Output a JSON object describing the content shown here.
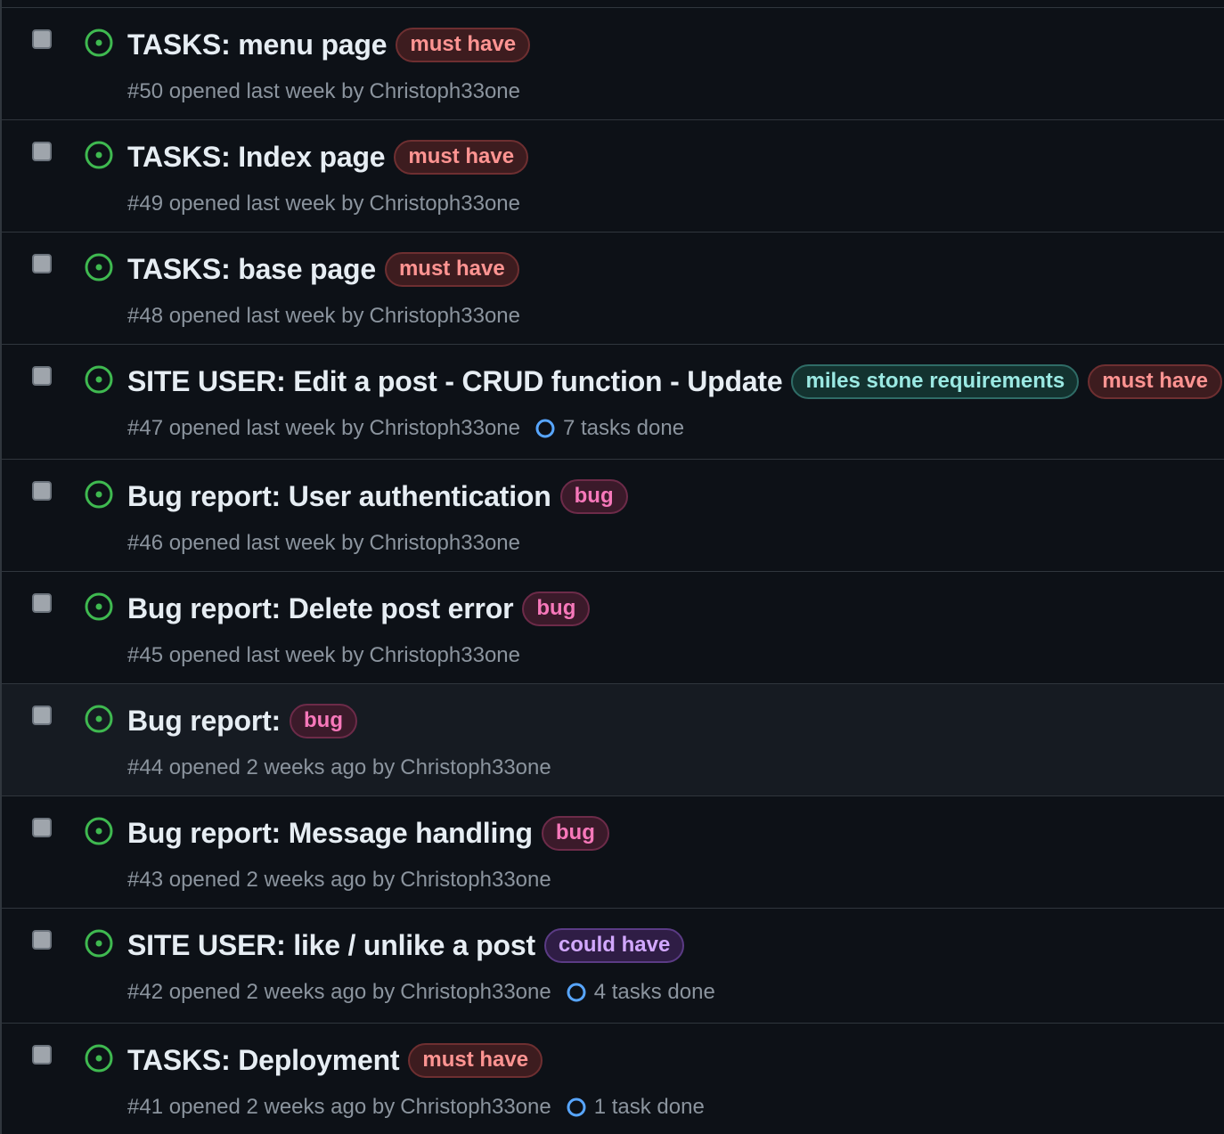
{
  "colors": {
    "open_icon": "#3fb950",
    "task_ring": "#58a6ff",
    "must_have": {
      "fg": "#ff9492",
      "bg": "#3d1c1f",
      "border": "#6e2f31"
    },
    "bug": {
      "fg": "#f778ba",
      "bg": "#3b1a2a",
      "border": "#6d2b49"
    },
    "milestone": {
      "fg": "#9be9e3",
      "bg": "#13322f",
      "border": "#2f6c66"
    },
    "could_have": {
      "fg": "#d2a8ff",
      "bg": "#2f1d45",
      "border": "#5b3b85"
    }
  },
  "issues": [
    {
      "title": "TASKS: menu page",
      "labels": [
        {
          "text": "must have",
          "kind": "must_have"
        }
      ],
      "number": "#50",
      "opened": "opened last week by",
      "author": "Christoph33one",
      "tasks": ""
    },
    {
      "title": "TASKS: Index page",
      "labels": [
        {
          "text": "must have",
          "kind": "must_have"
        }
      ],
      "number": "#49",
      "opened": "opened last week by",
      "author": "Christoph33one",
      "tasks": ""
    },
    {
      "title": "TASKS: base page",
      "labels": [
        {
          "text": "must have",
          "kind": "must_have"
        }
      ],
      "number": "#48",
      "opened": "opened last week by",
      "author": "Christoph33one",
      "tasks": ""
    },
    {
      "title": "SITE USER: Edit a post - CRUD function - Update",
      "labels": [
        {
          "text": "miles stone requirements",
          "kind": "milestone"
        },
        {
          "text": "must have",
          "kind": "must_have"
        }
      ],
      "number": "#47",
      "opened": "opened last week by",
      "author": "Christoph33one",
      "tasks": "7 tasks done"
    },
    {
      "title": "Bug report: User authentication",
      "labels": [
        {
          "text": "bug",
          "kind": "bug"
        }
      ],
      "number": "#46",
      "opened": "opened last week by",
      "author": "Christoph33one",
      "tasks": ""
    },
    {
      "title": "Bug report: Delete post error",
      "labels": [
        {
          "text": "bug",
          "kind": "bug"
        }
      ],
      "number": "#45",
      "opened": "opened last week by",
      "author": "Christoph33one",
      "tasks": ""
    },
    {
      "title": "Bug report:",
      "labels": [
        {
          "text": "bug",
          "kind": "bug"
        }
      ],
      "number": "#44",
      "opened": "opened 2 weeks ago by",
      "author": "Christoph33one",
      "tasks": "",
      "hover": true
    },
    {
      "title": "Bug report: Message handling",
      "labels": [
        {
          "text": "bug",
          "kind": "bug"
        }
      ],
      "number": "#43",
      "opened": "opened 2 weeks ago by",
      "author": "Christoph33one",
      "tasks": ""
    },
    {
      "title": "SITE USER: like / unlike a post",
      "labels": [
        {
          "text": "could have",
          "kind": "could_have"
        }
      ],
      "number": "#42",
      "opened": "opened 2 weeks ago by",
      "author": "Christoph33one",
      "tasks": "4 tasks done"
    },
    {
      "title": "TASKS: Deployment",
      "labels": [
        {
          "text": "must have",
          "kind": "must_have"
        }
      ],
      "number": "#41",
      "opened": "opened 2 weeks ago by",
      "author": "Christoph33one",
      "tasks": "1 task done"
    }
  ]
}
